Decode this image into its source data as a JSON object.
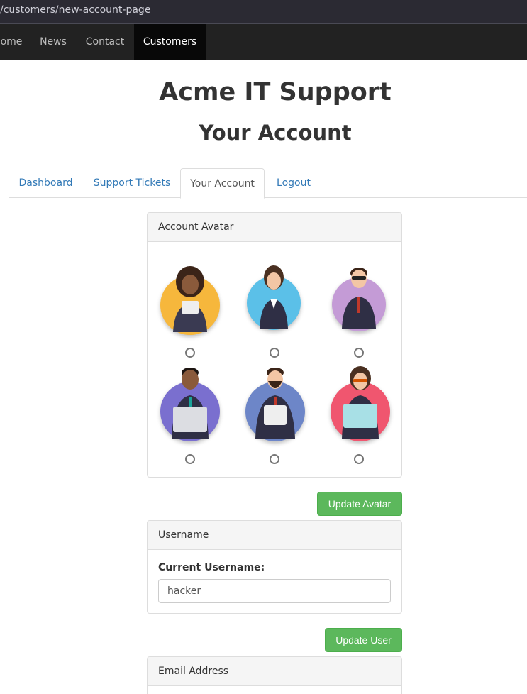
{
  "browser": {
    "url": "/customers/new-account-page"
  },
  "navbar": {
    "items": [
      {
        "label": "ome"
      },
      {
        "label": "News"
      },
      {
        "label": "Contact"
      },
      {
        "label": "Customers"
      }
    ]
  },
  "header": {
    "title": "Acme IT Support",
    "subtitle": "Your Account"
  },
  "tabs": [
    {
      "label": "Dashboard"
    },
    {
      "label": "Support Tickets"
    },
    {
      "label": "Your Account"
    },
    {
      "label": "Logout"
    }
  ],
  "avatar_panel": {
    "heading": "Account Avatar",
    "avatars": [
      {
        "color": "#f6b73c"
      },
      {
        "color": "#5bc0e8"
      },
      {
        "color": "#c49bd6"
      },
      {
        "color": "#7a6fcf"
      },
      {
        "color": "#6d86c8"
      },
      {
        "color": "#f0566f"
      }
    ],
    "button_label": "Update Avatar"
  },
  "username_panel": {
    "heading": "Username",
    "field_label": "Current Username:",
    "field_value": "hacker",
    "button_label": "Update User"
  },
  "email_panel": {
    "heading": "Email Address"
  },
  "colors": {
    "button_green": "#5cb85c",
    "link_blue": "#337ab7",
    "navbar": "#222222"
  }
}
